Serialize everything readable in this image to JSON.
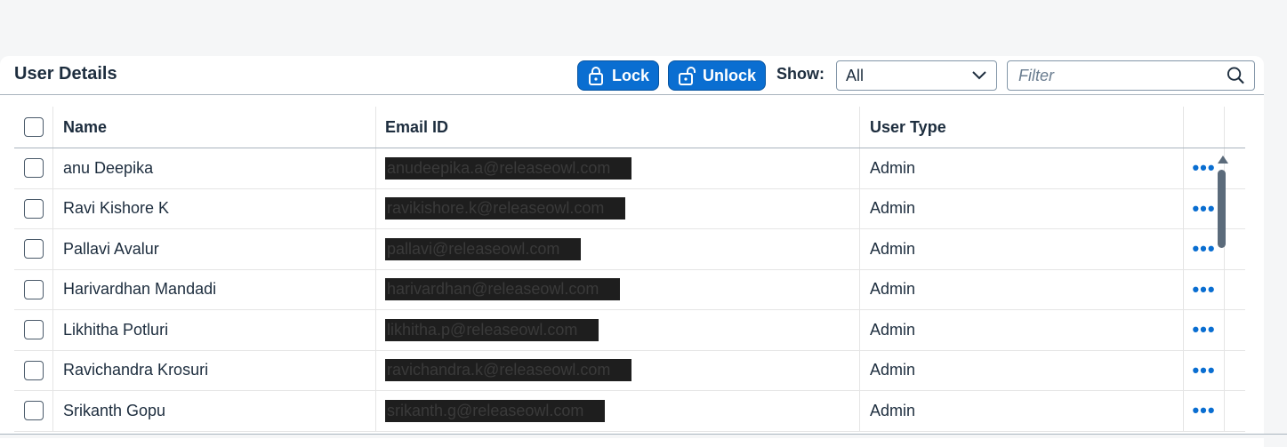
{
  "toolbar": {
    "title": "User Details",
    "lock_label": "Lock",
    "unlock_label": "Unlock",
    "show_label": "Show:",
    "show_value": "All",
    "filter_placeholder": "Filter",
    "accent_color": "#0a6ed1"
  },
  "table": {
    "columns": [
      "Name",
      "Email ID",
      "User Type"
    ],
    "rows": [
      {
        "name": "anu Deepika",
        "email": "anudeepika.a@releaseowl.com",
        "type": "Admin"
      },
      {
        "name": "Ravi Kishore K",
        "email": "ravikishore.k@releaseowl.com",
        "type": "Admin"
      },
      {
        "name": "Pallavi Avalur",
        "email": "pallavi@releaseowl.com",
        "type": "Admin"
      },
      {
        "name": "Harivardhan Mandadi",
        "email": "harivardhan@releaseowl.com",
        "type": "Admin"
      },
      {
        "name": "Likhitha Potluri",
        "email": "likhitha.p@releaseowl.com",
        "type": "Admin"
      },
      {
        "name": "Ravichandra Krosuri",
        "email": "ravichandra.k@releaseowl.com",
        "type": "Admin"
      },
      {
        "name": "Srikanth Gopu",
        "email": "srikanth.g@releaseowl.com",
        "type": "Admin"
      }
    ],
    "row_action_icon": "more-horizontal-icon"
  }
}
